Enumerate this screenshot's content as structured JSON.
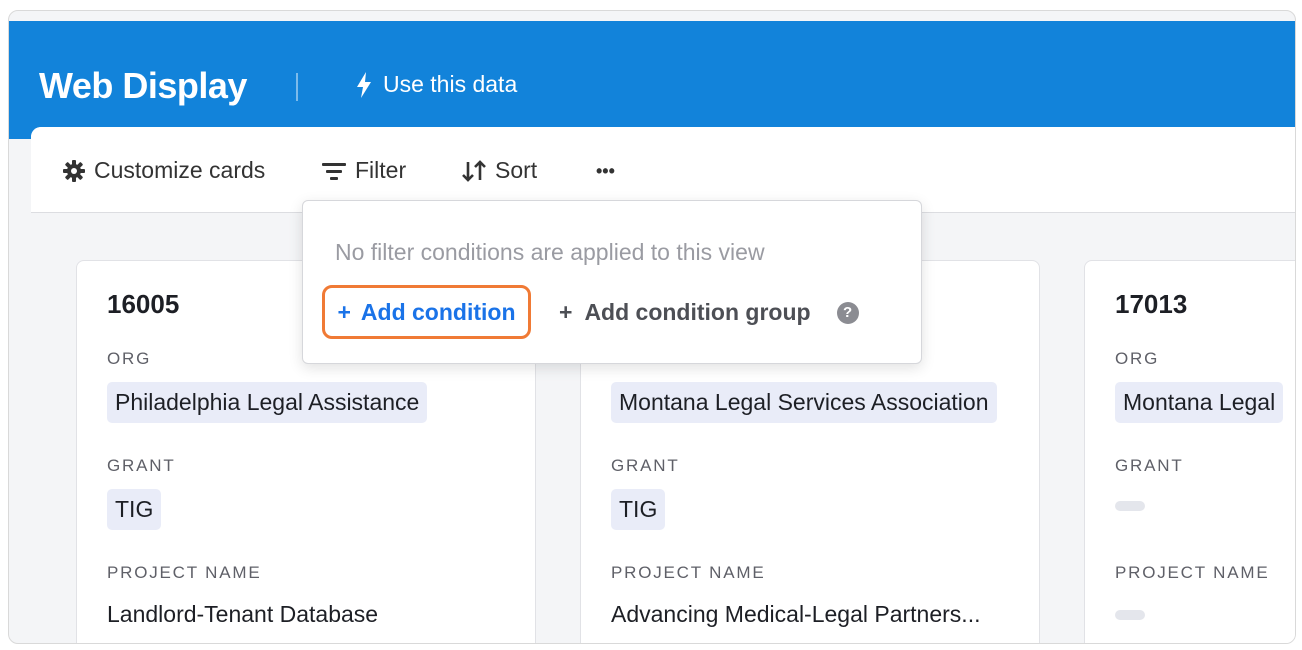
{
  "header": {
    "title": "Web Display",
    "use_data_label": "Use this data"
  },
  "toolbar": {
    "customize_label": "Customize cards",
    "filter_label": "Filter",
    "sort_label": "Sort",
    "more_label": "•••"
  },
  "filter_dropdown": {
    "empty_message": "No filter conditions are applied to this view",
    "add_condition_label": "Add condition",
    "add_group_label": "Add condition group",
    "plus": "+",
    "help": "?"
  },
  "cards": [
    {
      "title": "16005",
      "org_label": "ORG",
      "org": "Philadelphia Legal Assistance",
      "grant_label": "GRANT",
      "grant": "TIG",
      "project_label": "PROJECT NAME",
      "project": "Landlord-Tenant Database"
    },
    {
      "title": "",
      "org_label": "ORG",
      "org": "Montana Legal Services Association",
      "grant_label": "GRANT",
      "grant": "TIG",
      "project_label": "PROJECT NAME",
      "project": "Advancing Medical-Legal Partners..."
    },
    {
      "title": "17013",
      "org_label": "ORG",
      "org": "Montana Legal",
      "grant_label": "GRANT",
      "grant": "",
      "project_label": "PROJECT NAME",
      "project": ""
    }
  ],
  "colors": {
    "header_bg": "#1283da",
    "accent_blue": "#1a73e8",
    "highlight_orange": "#f07a35",
    "pill_bg": "#e9ecf8"
  }
}
